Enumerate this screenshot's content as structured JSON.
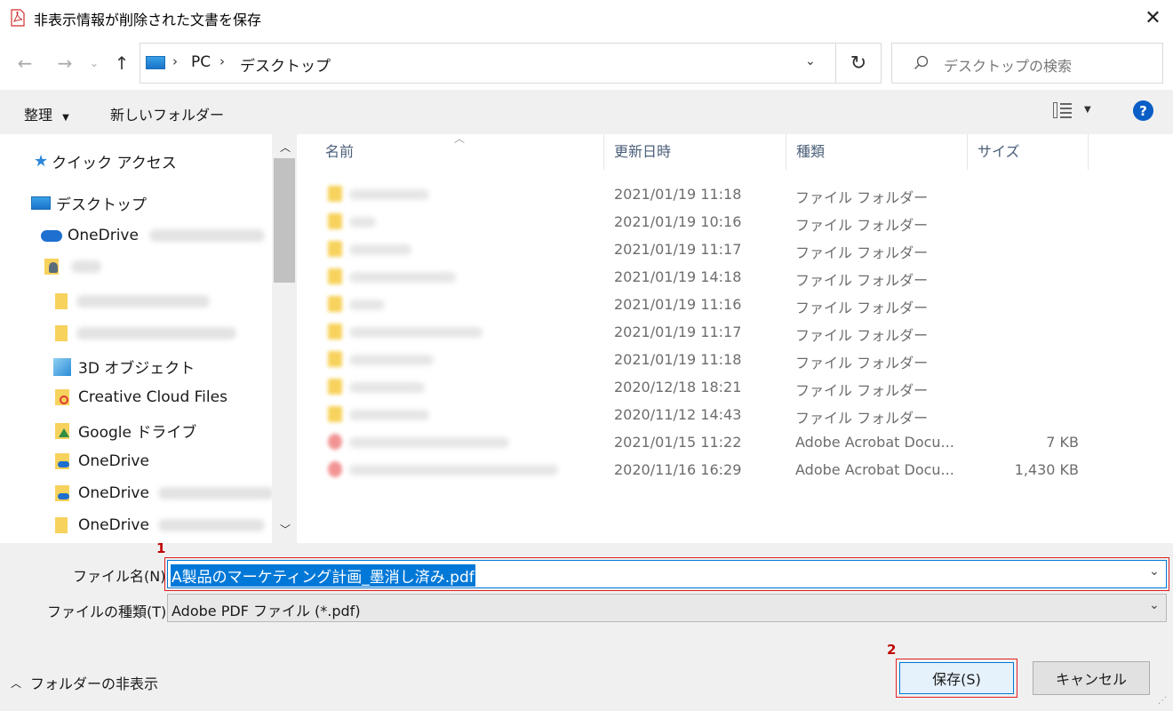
{
  "window": {
    "title": "非表示情報が削除された文書を保存"
  },
  "address": {
    "path": [
      "PC",
      "デスクトップ"
    ],
    "search_placeholder": "デスクトップの検索"
  },
  "toolbar": {
    "organize": "整理",
    "new_folder": "新しいフォルダー"
  },
  "nav": {
    "quick_access": "クイック アクセス",
    "desktop": "デスクトップ",
    "onedrive": "OneDrive",
    "objects3d": "3D オブジェクト",
    "creative_cloud": "Creative Cloud Files",
    "google_drive": "Google ドライブ",
    "onedrive2": "OneDrive",
    "onedrive3": "OneDrive",
    "onedrive4": "OneDrive"
  },
  "columns": {
    "name": "名前",
    "modified": "更新日時",
    "type": "種類",
    "size": "サイズ"
  },
  "files": [
    {
      "date": "2021/01/19 11:18",
      "type": "ファイル フォルダー",
      "size": ""
    },
    {
      "date": "2021/01/19 10:16",
      "type": "ファイル フォルダー",
      "size": ""
    },
    {
      "date": "2021/01/19 11:17",
      "type": "ファイル フォルダー",
      "size": ""
    },
    {
      "date": "2021/01/19 14:18",
      "type": "ファイル フォルダー",
      "size": ""
    },
    {
      "date": "2021/01/19 11:16",
      "type": "ファイル フォルダー",
      "size": ""
    },
    {
      "date": "2021/01/19 11:17",
      "type": "ファイル フォルダー",
      "size": ""
    },
    {
      "date": "2021/01/19 11:18",
      "type": "ファイル フォルダー",
      "size": ""
    },
    {
      "date": "2020/12/18 18:21",
      "type": "ファイル フォルダー",
      "size": ""
    },
    {
      "date": "2020/11/12 14:43",
      "type": "ファイル フォルダー",
      "size": ""
    },
    {
      "date": "2021/01/15 11:22",
      "type": "Adobe Acrobat Docu...",
      "size": "7 KB"
    },
    {
      "date": "2020/11/16 16:29",
      "type": "Adobe Acrobat Docu...",
      "size": "1,430 KB"
    }
  ],
  "form": {
    "filename_label": "ファイル名(N):",
    "filename_value": "A製品のマーケティング計画_墨消し済み.pdf",
    "filetype_label": "ファイルの種類(T):",
    "filetype_value": "Adobe PDF ファイル (*.pdf)"
  },
  "footer": {
    "hide_folders": "フォルダーの非表示",
    "save": "保存(S)",
    "cancel": "キャンセル",
    "marker1": "1",
    "marker2": "2"
  },
  "colors": {
    "selection": "#0078d7",
    "highlight_border": "#e02020",
    "folder": "#f7d25c",
    "pdf": "#f29494"
  }
}
